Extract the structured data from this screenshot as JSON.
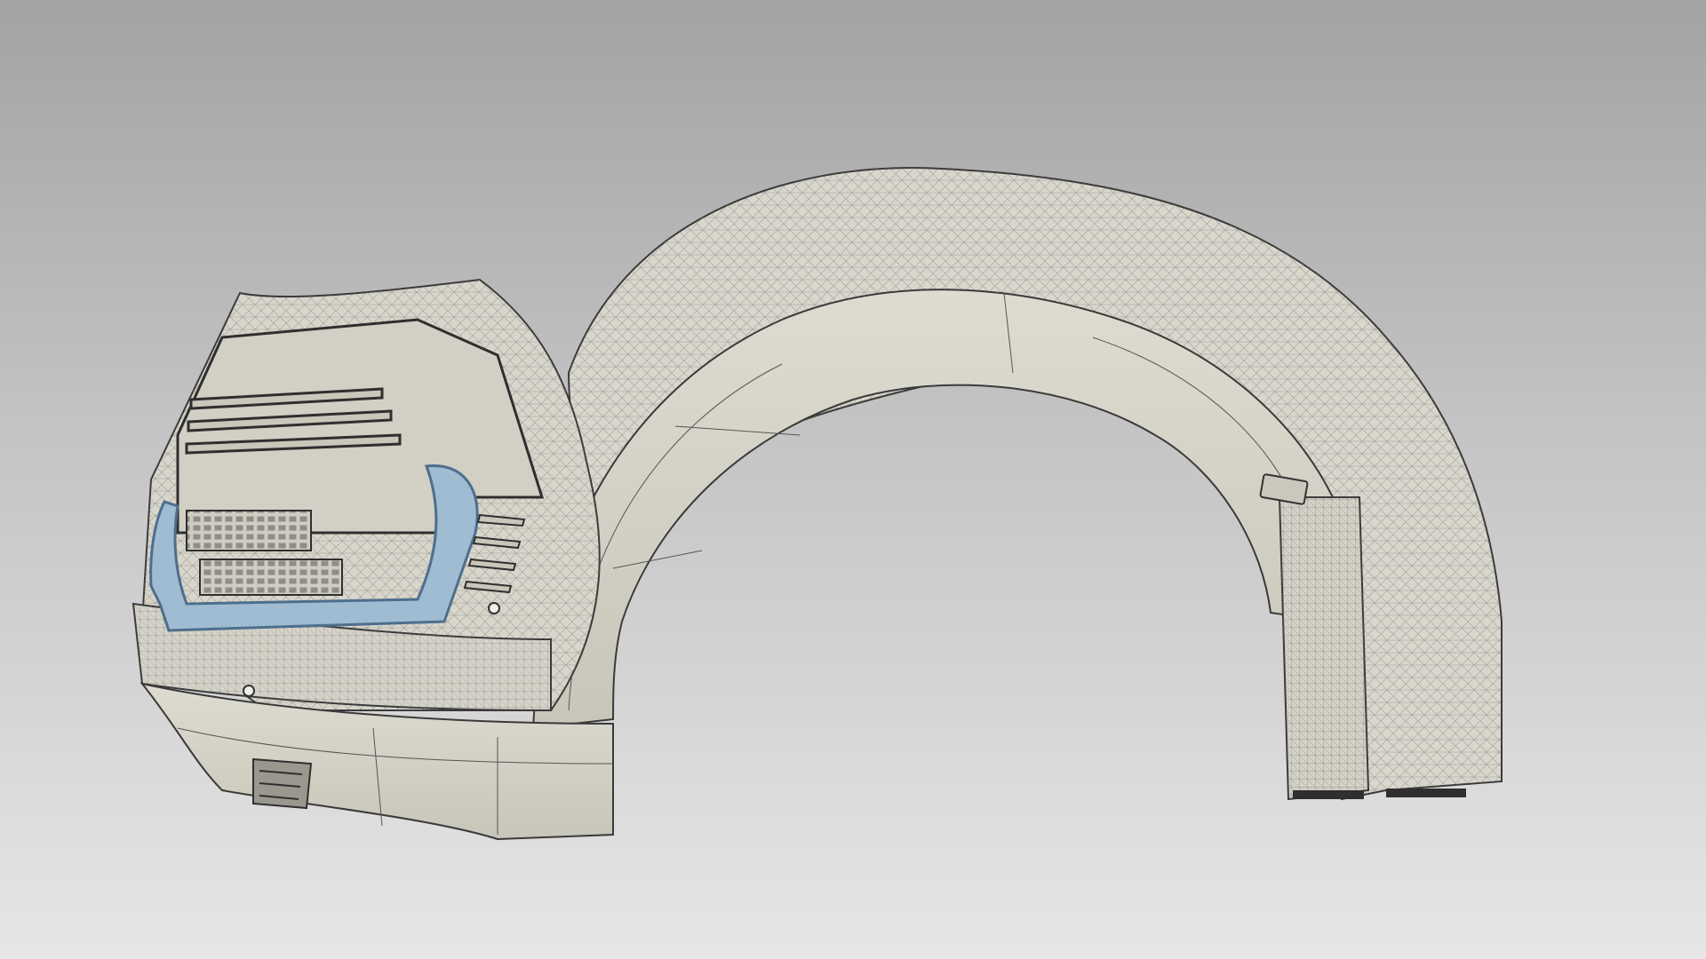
{
  "viewport": {
    "background_top": "#a3a3a3",
    "background_bottom": "#e6e6e6"
  },
  "model": {
    "surface_color": "#d6d3c8",
    "surface_shade": "#c4c1b5",
    "mesh_color": "#6e6e6e",
    "edge_color": "#3a3a3a",
    "highlight_color": "#9fbcd3",
    "highlight_edge": "#4d6f8c"
  }
}
